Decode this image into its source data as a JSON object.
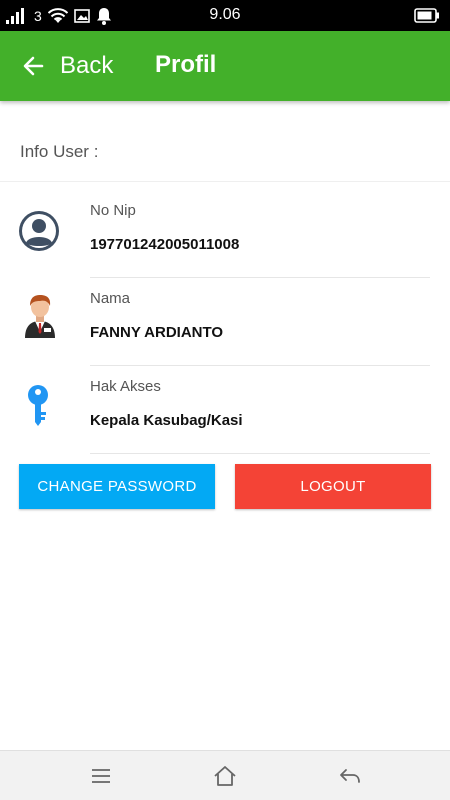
{
  "status_bar": {
    "carrier": "3",
    "time": "9.06",
    "icons": [
      "signal-icon",
      "wifi-icon",
      "image-icon",
      "bell-icon",
      "battery-icon"
    ]
  },
  "app_bar": {
    "back_label": "Back",
    "title": "Profil",
    "background_color": "#43b02a"
  },
  "section": {
    "title": "Info User :"
  },
  "info": [
    {
      "label": "No Nip",
      "value": "197701242005011008",
      "icon": "user-avatar-icon"
    },
    {
      "label": "Nama",
      "value": "FANNY ARDIANTO",
      "icon": "person-icon"
    },
    {
      "label": "Hak Akses",
      "value": "Kepala Kasubag/Kasi",
      "icon": "key-icon"
    }
  ],
  "buttons": {
    "change_password": "CHANGE PASSWORD",
    "logout": "LOGOUT",
    "change_password_color": "#03a9f4",
    "logout_color": "#f44336"
  },
  "nav_bar": {
    "icons": [
      "menu-icon",
      "home-icon",
      "back-arrow-icon"
    ]
  }
}
